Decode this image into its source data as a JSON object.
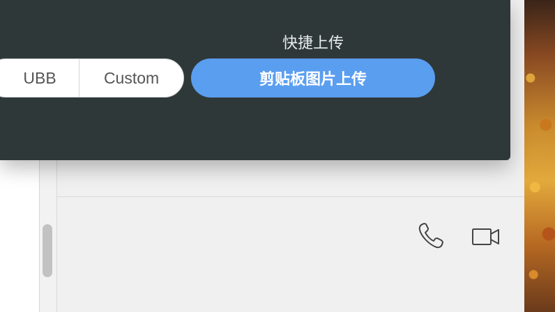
{
  "upload_panel": {
    "quick_upload_title": "快捷上传",
    "formats": [
      {
        "label": "UBB"
      },
      {
        "label": "Custom"
      }
    ],
    "clipboard_upload_label": "剪贴板图片上传",
    "accent_color": "#5a9ef0"
  },
  "chat_toolbar": {
    "icons": [
      "phone-icon",
      "video-camera-icon"
    ]
  }
}
